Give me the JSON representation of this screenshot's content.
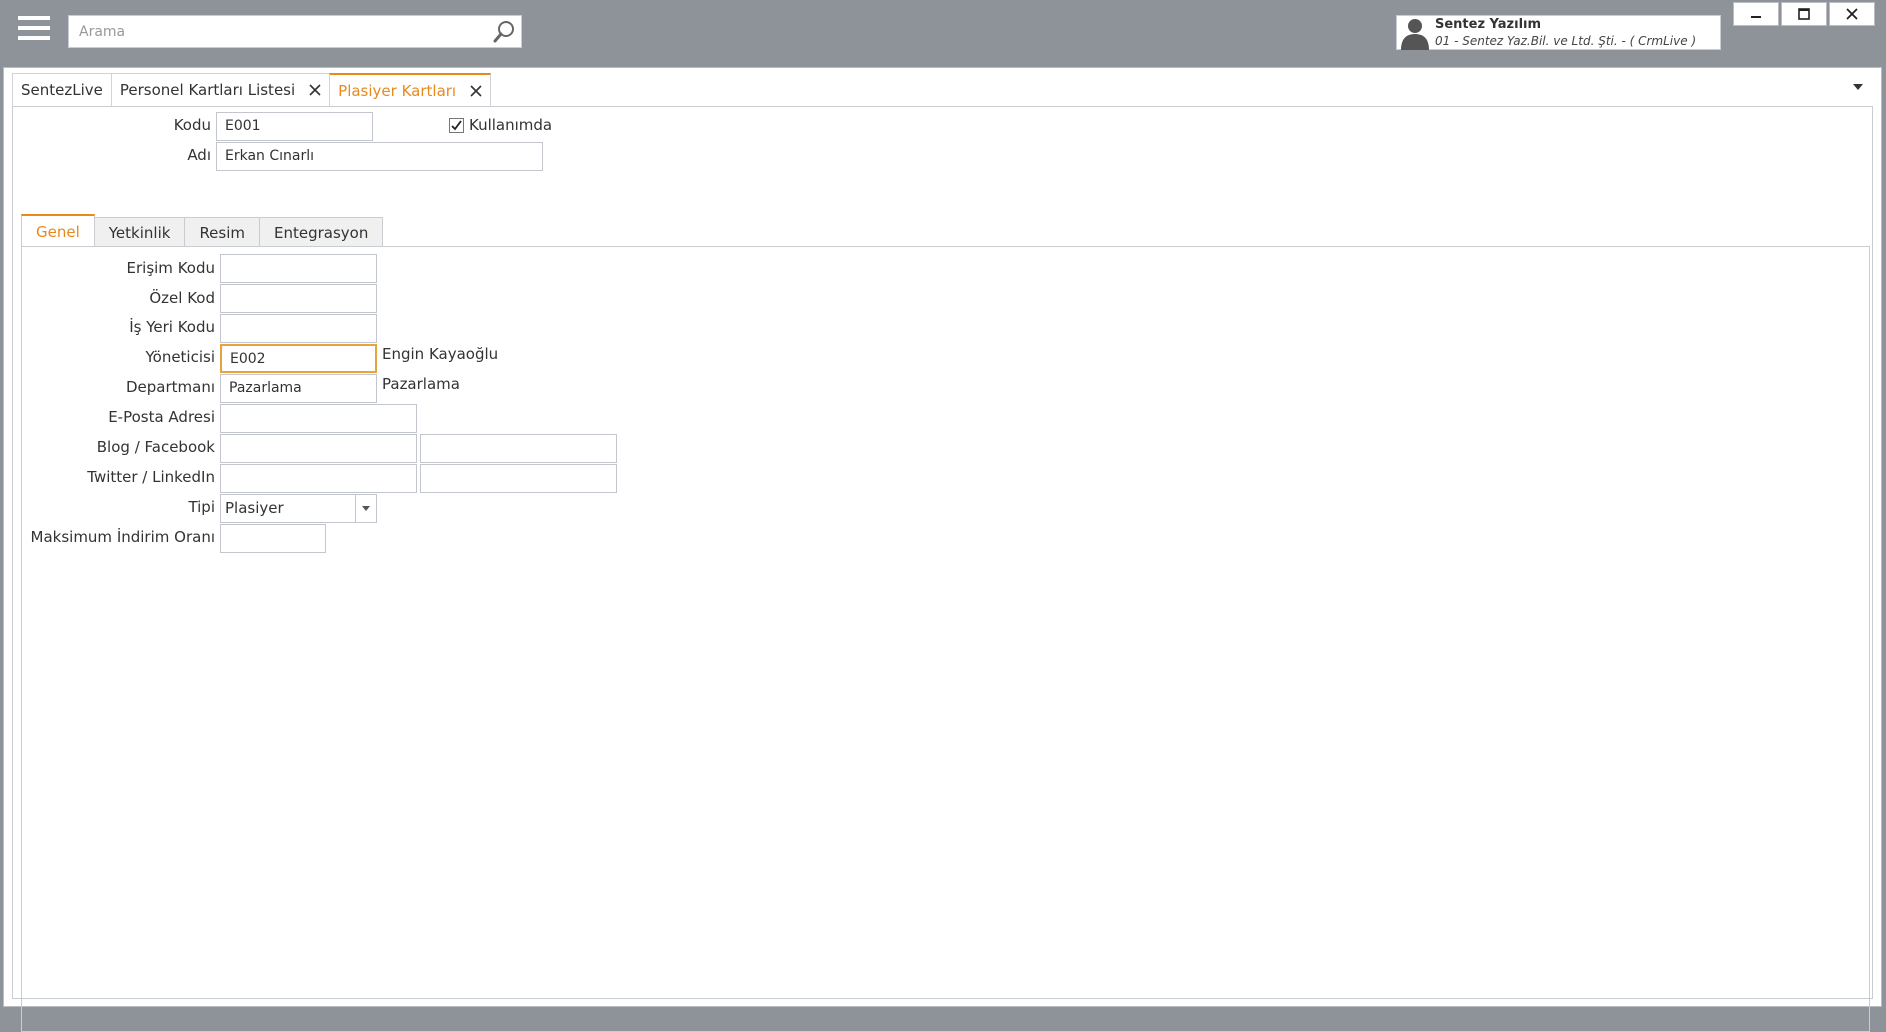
{
  "search": {
    "placeholder": "Arama"
  },
  "user": {
    "name": "Sentez Yazılım",
    "company": "01 - Sentez Yaz.Bil. ve Ltd. Şti. - ( CrmLive )"
  },
  "doc_tabs": [
    {
      "label": "SentezLive"
    },
    {
      "label": "Personel Kartları Listesi"
    },
    {
      "label": "Plasiyer Kartları"
    }
  ],
  "header": {
    "kodu_label": "Kodu",
    "kodu_value": "E001",
    "adi_label": "Adı",
    "adi_value": "Erkan Cınarlı",
    "kullanimda_label": "Kullanımda",
    "kullanimda_checked": true
  },
  "inner_tabs": [
    {
      "label": "Genel"
    },
    {
      "label": "Yetkinlik"
    },
    {
      "label": "Resim"
    },
    {
      "label": "Entegrasyon"
    }
  ],
  "form": {
    "erisim_kodu_label": "Erişim Kodu",
    "erisim_kodu_value": "",
    "ozel_kod_label": "Özel Kod",
    "ozel_kod_value": "",
    "is_yeri_kodu_label": "İş Yeri Kodu",
    "is_yeri_kodu_value": "",
    "yonetici_label": "Yöneticisi",
    "yonetici_value": "E002",
    "yonetici_name": "Engin Kayaoğlu",
    "departman_label": "Departmanı",
    "departman_value": "Pazarlama",
    "departman_name": "Pazarlama",
    "eposta_label": "E-Posta Adresi",
    "eposta_value": "",
    "blog_facebook_label": "Blog / Facebook",
    "blog_value": "",
    "facebook_value": "",
    "twitter_linkedin_label": "Twitter / LinkedIn",
    "twitter_value": "",
    "linkedin_value": "",
    "tipi_label": "Tipi",
    "tipi_value": "Plasiyer",
    "maks_indirim_label": "Maksimum İndirim Oranı",
    "maks_indirim_value": ""
  },
  "colors": {
    "accent": "#e8891c",
    "background": "#8e9299"
  }
}
